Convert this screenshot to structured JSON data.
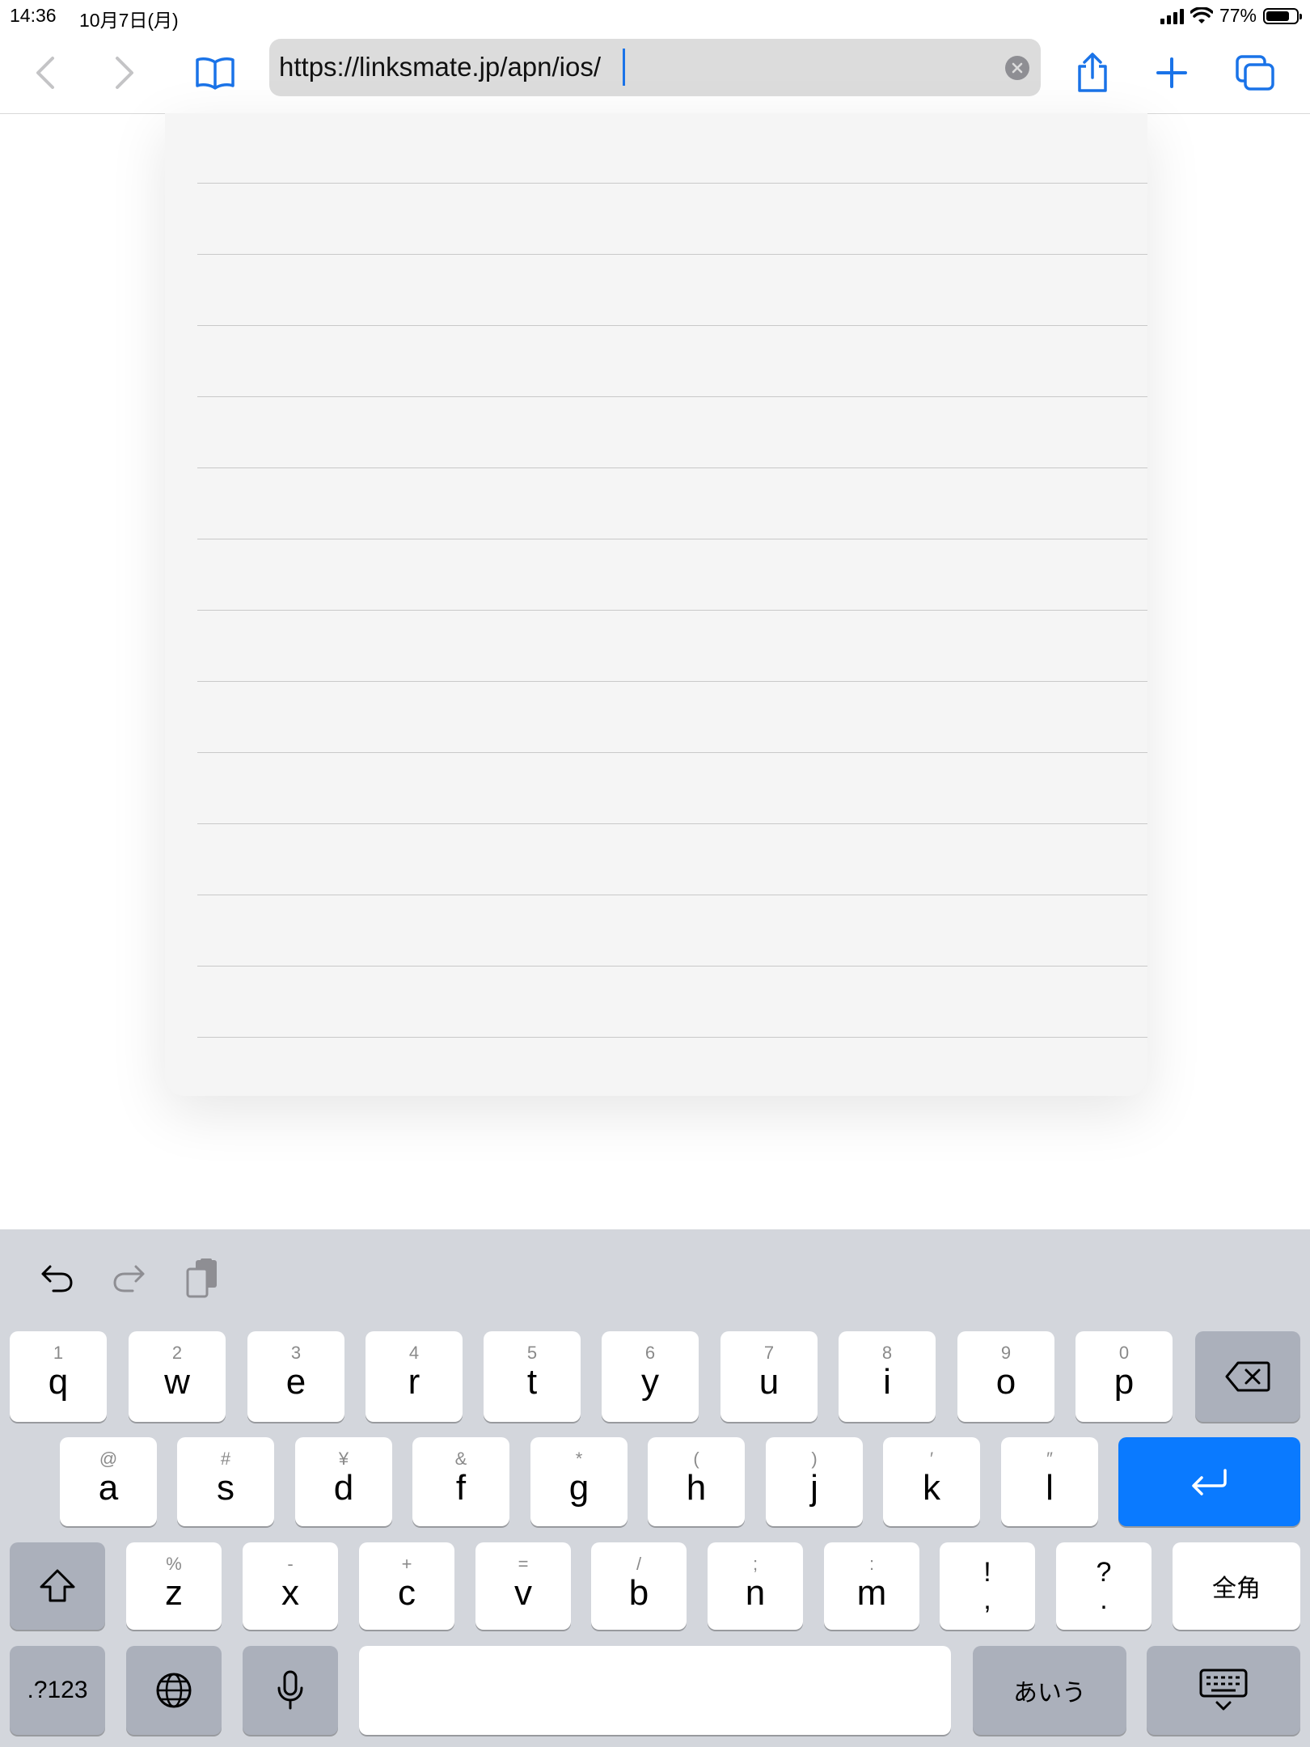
{
  "status_bar": {
    "time": "14:36",
    "date": "10月7日(月)",
    "battery_text": "77%",
    "battery_level": 0.77
  },
  "toolbar": {
    "url": "https://linksmate.jp/apn/ios/",
    "accent_color": "#1a73e8",
    "icons": [
      "chevron-left-icon",
      "chevron-right-icon",
      "book-icon",
      "clear-icon",
      "share-icon",
      "plus-icon",
      "tabs-icon"
    ]
  },
  "keyboard": {
    "row1": [
      {
        "sub": "1",
        "main": "q"
      },
      {
        "sub": "2",
        "main": "w"
      },
      {
        "sub": "3",
        "main": "e"
      },
      {
        "sub": "4",
        "main": "r"
      },
      {
        "sub": "5",
        "main": "t"
      },
      {
        "sub": "6",
        "main": "y"
      },
      {
        "sub": "7",
        "main": "u"
      },
      {
        "sub": "8",
        "main": "i"
      },
      {
        "sub": "9",
        "main": "o"
      },
      {
        "sub": "0",
        "main": "p"
      }
    ],
    "row2": [
      {
        "sub": "@",
        "main": "a"
      },
      {
        "sub": "#",
        "main": "s"
      },
      {
        "sub": "¥",
        "main": "d"
      },
      {
        "sub": "&",
        "main": "f"
      },
      {
        "sub": "*",
        "main": "g"
      },
      {
        "sub": "(",
        "main": "h"
      },
      {
        "sub": ")",
        "main": "j"
      },
      {
        "sub": "′",
        "main": "k"
      },
      {
        "sub": "″",
        "main": "l"
      }
    ],
    "row3": [
      {
        "sub": "%",
        "main": "z"
      },
      {
        "sub": "-",
        "main": "x"
      },
      {
        "sub": "+",
        "main": "c"
      },
      {
        "sub": "=",
        "main": "v"
      },
      {
        "sub": "/",
        "main": "b"
      },
      {
        "sub": ";",
        "main": "n"
      },
      {
        "sub": ":",
        "main": "m"
      }
    ],
    "punct1": {
      "top": "!",
      "bottom": ","
    },
    "punct2": {
      "top": "?",
      "bottom": "."
    },
    "zenkaku": "全角",
    "numbers_key": ".?123",
    "kana_key": "あいう",
    "return_color": "#0a7aff"
  }
}
